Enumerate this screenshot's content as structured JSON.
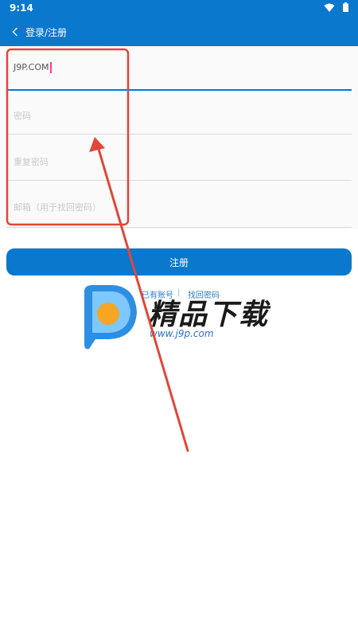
{
  "status": {
    "time": "9:14"
  },
  "app_bar": {
    "title": "登录/注册"
  },
  "form": {
    "username_value": "J9P.COM",
    "password_placeholder": "密码",
    "confirm_placeholder": "重复密码",
    "email_placeholder": "邮箱（用于找回密码）"
  },
  "register_button": "注册",
  "links": {
    "has_account": "已有账号",
    "separator": "|",
    "forgot": "找回密码"
  },
  "watermark": {
    "title": "精品下载",
    "url": "www.j9p.com"
  },
  "colors": {
    "primary": "#0a78cc",
    "annotation": "#e2463a",
    "cursor": "#ff3a8c"
  },
  "icons": [
    "wifi-icon",
    "battery-icon",
    "back-chevron-icon",
    "j9p-logo"
  ]
}
